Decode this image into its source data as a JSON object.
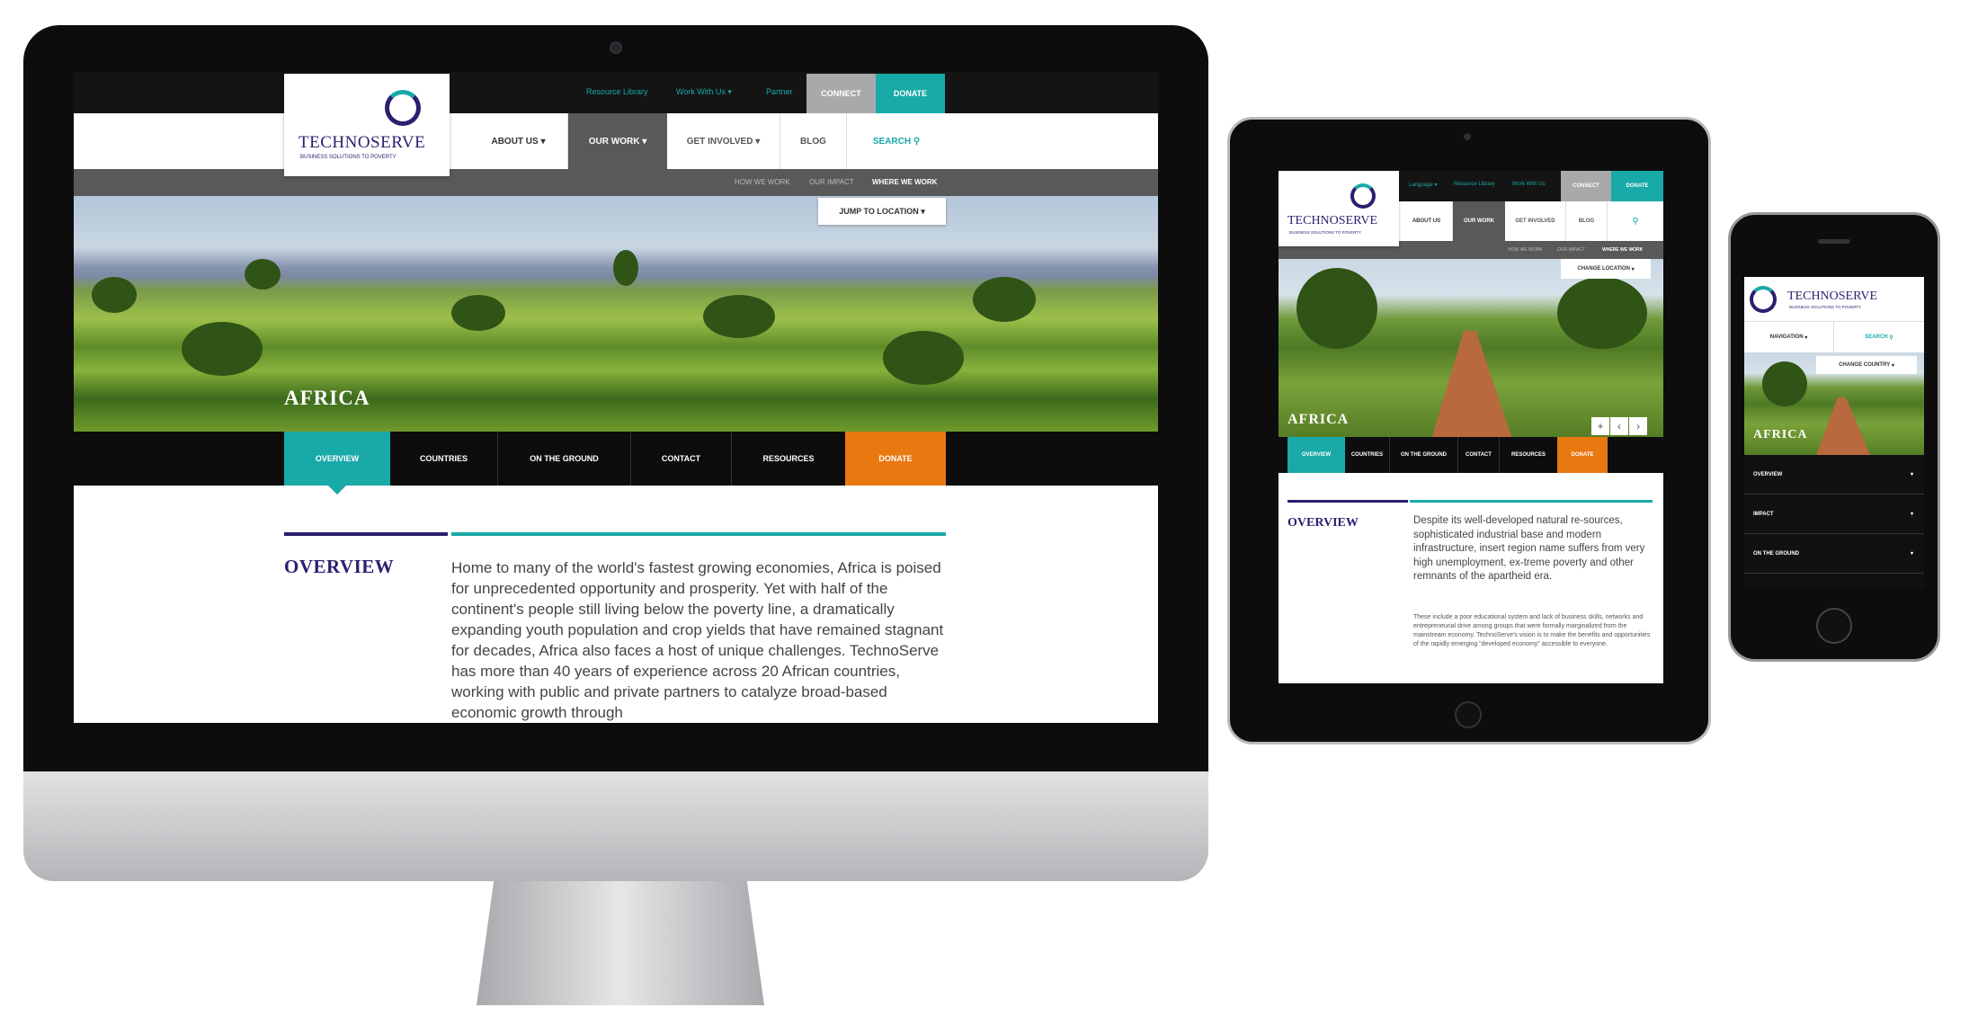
{
  "desktop": {
    "utility": [
      "Resource Library",
      "Work With Us",
      "Partner"
    ],
    "connect": "CONNECT",
    "donate": "DONATE",
    "logo": {
      "name": "TECHNOSERVE",
      "tagline": "BUSINESS SOLUTIONS TO POVERTY"
    },
    "nav": [
      "ABOUT US",
      "OUR WORK",
      "GET INVOLVED",
      "BLOG",
      "SEARCH"
    ],
    "subnav": [
      "HOW WE WORK",
      "OUR IMPACT",
      "WHERE WE WORK"
    ],
    "jump": "JUMP TO LOCATION",
    "region": "AFRICA",
    "tabs": [
      "OVERVIEW",
      "COUNTRIES",
      "ON THE GROUND",
      "CONTACT",
      "RESOURCES",
      "DONATE"
    ],
    "heading": "OVERVIEW",
    "body": "Home to many of the world's fastest growing economies, Africa is poised for unprecedented opportunity and prosperity. Yet with half of the continent's people still living below the poverty line, a dramatically expanding youth population and crop yields that have remained stagnant for decades, Africa also faces a host of unique challenges. TechnoServe has more than 40 years of experience across 20 African countries, working with public and private partners to catalyze broad-based economic growth through"
  },
  "tablet": {
    "utility": [
      "Language",
      "Resource Library",
      "Work With Us"
    ],
    "connect": "CONNECT",
    "donate": "DONATE",
    "logo": {
      "name": "TECHNOSERVE",
      "tagline": "BUSINESS SOLUTIONS TO POVERTY"
    },
    "nav": [
      "ABOUT US",
      "OUR WORK",
      "GET INVOLVED",
      "BLOG"
    ],
    "subnav": [
      "HOW WE WORK",
      "OUR IMPACT",
      "WHERE WE WORK"
    ],
    "change": "CHANGE LOCATION",
    "region": "AFRICA",
    "tabs": [
      "OVERVIEW",
      "COUNTRIES",
      "ON THE GROUND",
      "CONTACT",
      "RESOURCES",
      "DONATE"
    ],
    "heading": "OVERVIEW",
    "lead": "Despite its well-developed natural re-sources, sophisticated industrial base and modern infrastructure, insert region name suffers from very high unemployment, ex-treme poverty and other remnants of the apartheid era.",
    "small": "These include a poor educational system and lack of business skills, networks and entrepreneurial drive among groups that were formally marginalized from the mainstream economy. TechnoServe's vision is to make the benefits and opportunities of the rapidly emerging \"developed economy\" accessible to everyone."
  },
  "phone": {
    "logo": {
      "name": "TECHNOSERVE",
      "tagline": "BUSINESS SOLUTIONS TO POVERTY"
    },
    "navigation": "NAVIGATION",
    "search": "SEARCH",
    "change": "CHANGE COUNTRY",
    "region": "AFRICA",
    "accordion": [
      "OVERVIEW",
      "IMPACT",
      "ON THE GROUND"
    ]
  },
  "colors": {
    "teal": "#19a9a7",
    "navy": "#2a1f6e",
    "orange": "#e87810"
  }
}
